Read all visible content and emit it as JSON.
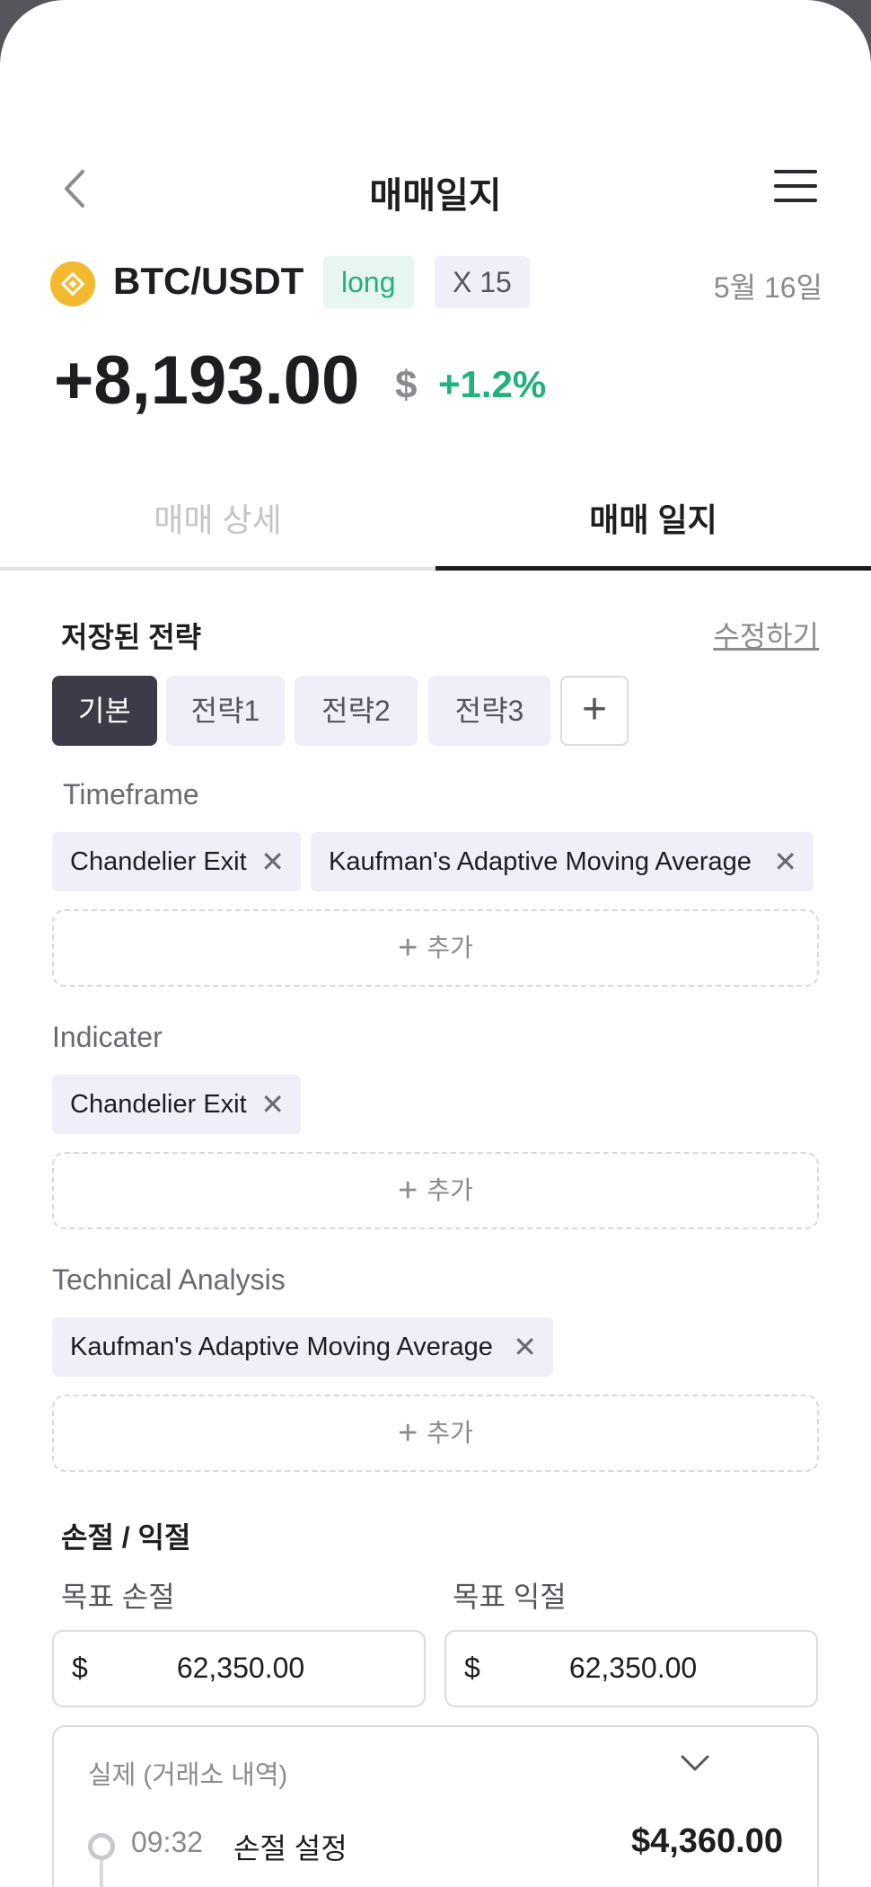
{
  "header": {
    "title": "매매일지"
  },
  "trade": {
    "pair": "BTC/USDT",
    "side": "long",
    "leverage": "X 15",
    "date": "5월 16일",
    "pnl": "+8,193.00",
    "pnl_unit": "$",
    "pnl_percent": "+1.2%"
  },
  "tabs": [
    {
      "label": "매매 상세",
      "active": false
    },
    {
      "label": "매매 일지",
      "active": true
    }
  ],
  "strategy": {
    "title": "저장된 전략",
    "edit_label": "수정하기",
    "chips": [
      {
        "label": "기본",
        "active": true
      },
      {
        "label": "전략1",
        "active": false
      },
      {
        "label": "전략2",
        "active": false
      },
      {
        "label": "전략3",
        "active": false
      }
    ],
    "add_symbol": "+"
  },
  "groups": {
    "timeframe": {
      "label": "Timeframe",
      "tags": [
        "Chandelier Exit",
        "Kaufman's Adaptive Moving Average"
      ],
      "add_label": "추가"
    },
    "indicater": {
      "label": "Indicater",
      "tags": [
        "Chandelier Exit"
      ],
      "add_label": "추가"
    },
    "technical": {
      "label": "Technical Analysis",
      "tags": [
        "Kaufman's Adaptive Moving Average"
      ],
      "add_label": "추가"
    }
  },
  "loss_profit": {
    "title": "손절 / 익절",
    "target_loss": {
      "label": "목표 손절",
      "currency": "$",
      "value": "62,350.00"
    },
    "target_profit": {
      "label": "목표 익절",
      "currency": "$",
      "value": "62,350.00"
    }
  },
  "history": {
    "title": "실제 (거래소 내역)",
    "entries": [
      {
        "time": "09:32",
        "label": "손절 설정",
        "amount": "$4,360.00"
      }
    ]
  },
  "colors": {
    "accent_green": "#22b07d",
    "dark_chip": "#3b3c48",
    "chip_bg": "#efeffa",
    "coin": "#f3ba2f"
  },
  "icons": {
    "back": "chevron-left-icon",
    "menu": "hamburger-menu-icon",
    "coin": "binance-coin-icon",
    "remove": "close-icon",
    "add": "plus-icon",
    "expand": "chevron-down-icon"
  }
}
